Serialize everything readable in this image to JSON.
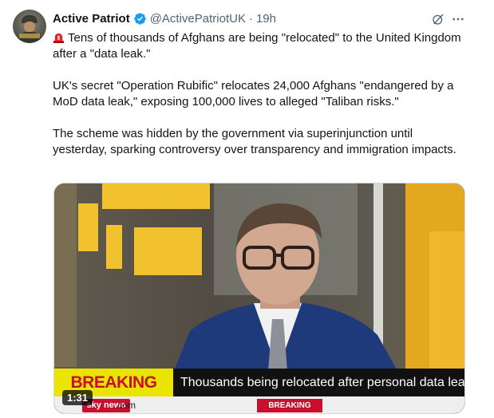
{
  "author": {
    "name": "Active Patriot",
    "handle": "@ActivePatriotUK",
    "separator": "·",
    "time": "19h"
  },
  "icons": {
    "verified": "verified-badge-icon",
    "grok": "grok-icon",
    "more": "more-icon",
    "siren": "siren-emoji-icon"
  },
  "colors": {
    "verified_blue": "#1d9bf0",
    "secondary_text": "#536471",
    "breaking_yellow": "#e9e400",
    "sky_red": "#c8102e"
  },
  "tweet": {
    "paragraph1": "Tens of thousands of Afghans are being \"relocated\" to the United Kingdom after a \"data leak.\"",
    "paragraph2": "UK's secret \"Operation Rubific\" relocates 24,000 Afghans \"endangered by a MoD data leak,\" exposing 100,000 lives to alleged \"Taliban risks.\"",
    "paragraph3": "The scheme was hidden by the government via superinjunction until yesterday, sparking controversy over transparency and immigration impacts."
  },
  "video": {
    "breaking_label": "BREAKING NEWS",
    "headline": "Thousands being relocated after personal data leak",
    "sky_logo": "sky news",
    "dotcom": ".com",
    "sub_breaking": "BREAKING NEWS",
    "duration": "1:31"
  }
}
